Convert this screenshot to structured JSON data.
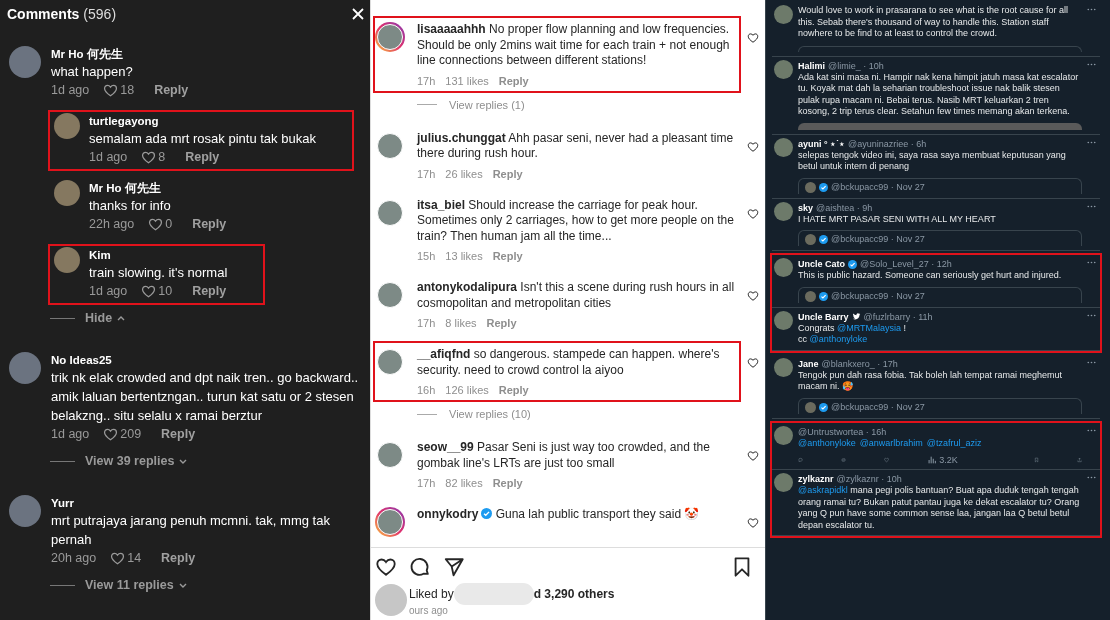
{
  "tiktok": {
    "title": "Comments",
    "count": "(596)",
    "comments": [
      {
        "user": "Mr Ho 何先生",
        "text": "what happen?",
        "time": "1d ago",
        "likes": "18",
        "reply": "Reply",
        "highlighted": false,
        "children": [
          {
            "user": "turtlegayong",
            "text": "semalam ada mrt rosak pintu tak bukak",
            "time": "1d ago",
            "likes": "8",
            "reply": "Reply",
            "highlighted": true
          },
          {
            "user": "Mr Ho 何先生",
            "text": "thanks for info",
            "time": "22h ago",
            "likes": "0",
            "reply": "Reply",
            "highlighted": false
          },
          {
            "user": "Kim",
            "text": "train slowing. it's normal",
            "time": "1d ago",
            "likes": "10",
            "reply": "Reply",
            "highlighted": true
          }
        ],
        "toggle": {
          "label": "Hide",
          "expanded": true
        }
      },
      {
        "user": "No Ideas25",
        "text": "trik nk elak crowded and dpt naik tren.. go backward.. amik laluan bertentzngan.. turun kat satu or 2 stesen belakzng.. situ selalu x ramai berztur",
        "time": "1d ago",
        "likes": "209",
        "reply": "Reply",
        "highlighted": false,
        "toggle": {
          "label": "View 39 replies",
          "expanded": false
        }
      },
      {
        "user": "Yurr",
        "text": "mrt putrajaya jarang penuh mcmni. tak, mmg tak pernah",
        "time": "20h ago",
        "likes": "14",
        "reply": "Reply",
        "highlighted": false,
        "toggle": {
          "label": "View 11 replies",
          "expanded": false
        }
      }
    ]
  },
  "instagram": {
    "comments": [
      {
        "user": "lisaaaaahhh",
        "text": "No proper flow planning and low frequencies. Should be only 2mins wait time for each train + not enough line connections between different stations!",
        "time": "17h",
        "likes": "131 likes",
        "reply": "Reply",
        "highlighted": true,
        "story_ring": true,
        "view_replies": "View replies (1)"
      },
      {
        "user": "julius.chunggat",
        "text": "Ahh pasar seni, never had a pleasant time there during rush hour.",
        "time": "17h",
        "likes": "26 likes",
        "reply": "Reply",
        "highlighted": false,
        "story_ring": false
      },
      {
        "user": "itsa_biel",
        "text": "Should increase the carriage for peak hour. Sometimes only 2 carriages, how to get more people on the train? Then human jam all the time...",
        "time": "15h",
        "likes": "13 likes",
        "reply": "Reply",
        "highlighted": false,
        "story_ring": false
      },
      {
        "user": "antonykodalipura",
        "text": "Isn't this a scene during rush hours in all cosmopolitan and metropolitan cities",
        "time": "17h",
        "likes": "8 likes",
        "reply": "Reply",
        "highlighted": false,
        "story_ring": false
      },
      {
        "user": "__afiqfnd",
        "text": "so dangerous. stampede can happen. where's security. need to crowd control la aiyoo",
        "time": "16h",
        "likes": "126 likes",
        "reply": "Reply",
        "highlighted": true,
        "story_ring": false,
        "view_replies": "View replies (10)"
      },
      {
        "user": "seow__99",
        "text": "Pasar Seni is just way too crowded, and the gombak line's LRTs are just too small",
        "time": "17h",
        "likes": "82 likes",
        "reply": "Reply",
        "highlighted": false,
        "story_ring": false
      },
      {
        "user": "onnykodry",
        "verified": true,
        "text": "Guna lah public transport they said 🤡",
        "highlighted": false,
        "story_ring": true
      }
    ],
    "liked_by": "Liked by",
    "liked_others": "d 3,290 others",
    "posted": "ours ago"
  },
  "x": {
    "sections": [
      {
        "highlighted": false,
        "tweets": [
          {
            "text": "Would love to work in prasarana to see what is the root cause for all this. Sebab there's thousand of way to handle this. Station staff nowhere to be find to at least to control the crowd.",
            "quote_edge": true
          },
          {
            "name": "Halimi",
            "handle_time": "@limie_ · 10h",
            "text": "Ada kat sini masa ni. Hampir nak kena himpit jatuh masa kat escalator tu. Koyak mat dah la seharian troubleshoot issue nak balik stesen pulak rupa macam ni. Bebai terus. Nasib MRT keluarkan 2 tren kosong, 2 trip terus clear. Setahun few times memang akan terkena.",
            "media": true
          },
          {
            "name": "ayuni ° ⋆˙⋆",
            "handle_time": "@ayuninazriee · 6h",
            "text": "selepas tengok video ini, saya rasa saya membuat keputusan yang betul untuk intern di penang",
            "quote": {
              "handle_time": "@bckupacc99 · Nov 27"
            }
          },
          {
            "name": "sky",
            "handle_time": "@aishtea · 9h",
            "text": "I HATE MRT PASAR SENI WITH ALL MY HEART",
            "quote": {
              "handle_time": "@bckupacc99 · Nov 27"
            }
          }
        ]
      },
      {
        "highlighted": true,
        "tweets": [
          {
            "name": "Uncle Cato",
            "verified": true,
            "handle_time": "@Solo_Level_27 · 12h",
            "text": "This is public hazard. Someone can seriously get hurt and injured.",
            "quote": {
              "handle_time": "@bckupacc99 · Nov 27"
            }
          },
          {
            "name": "Uncle Barry",
            "bird_badge": true,
            "handle_time": "@fuzlrbarry · 11h",
            "text_parts": [
              [
                {
                  "text": "Congrats ",
                  "kind": "plain"
                },
                {
                  "text": "@MRTMalaysia",
                  "kind": "mention"
                },
                {
                  "text": " !",
                  "kind": "plain"
                }
              ],
              [
                {
                  "text": "cc ",
                  "kind": "plain"
                },
                {
                  "text": "@anthonyloke",
                  "kind": "mention"
                }
              ]
            ]
          }
        ]
      },
      {
        "highlighted": false,
        "tweets": [
          {
            "name": "Jane",
            "handle_time": "@blankxero_ · 17h",
            "text": "Tengok pun dah rasa fobia. Tak boleh lah tempat ramai meghemut macam ni. 🥵",
            "quote": {
              "handle_time": "@bckupacc99 · Nov 27"
            }
          }
        ]
      },
      {
        "highlighted": true,
        "tweets": [
          {
            "handle_time": "@Untrustwortea · 16h",
            "text_parts": [
              [
                {
                  "text": "@anthonyloke",
                  "kind": "mention"
                },
                {
                  "text": "@anwarlbrahim",
                  "kind": "mention"
                },
                {
                  "text": "@tzafrul_aziz",
                  "kind": "mention"
                }
              ]
            ],
            "actions": {
              "views": "3.2K"
            }
          },
          {
            "name": "zylkaznr",
            "handle_time": "@zylkaznr · 10h",
            "text_parts": [
              [
                {
                  "text": "@askrapidkl",
                  "kind": "mention"
                },
                {
                  "text": " mana pegi polis bantuan? Buat apa duduk tengah tengah orang ramai tu? Bukan patut pantau juga ke dekat escalator tu? Orang yang Q pun have some common sense laa, jangan laa Q betul betul depan escalator tu.",
                  "kind": "plain"
                }
              ]
            ]
          }
        ]
      }
    ]
  }
}
